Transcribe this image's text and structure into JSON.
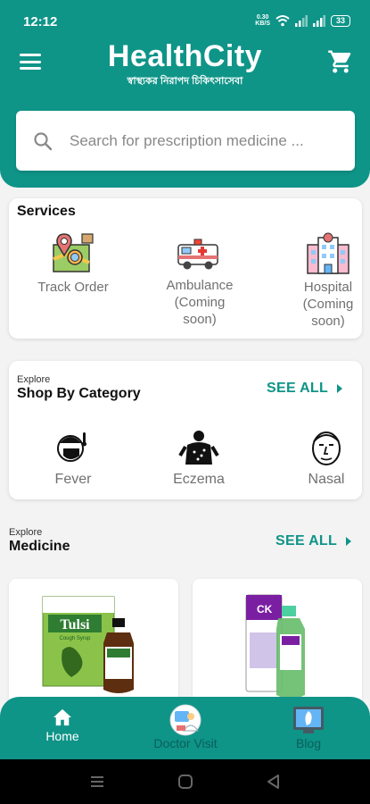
{
  "status": {
    "time": "12:12",
    "speed": "0.30",
    "speed_unit": "KB/S",
    "battery": "33"
  },
  "brand": {
    "name": "HealthCity",
    "tagline": "স্বাস্থ্যকর নিরাপদ চিকিৎসাসেবা"
  },
  "search": {
    "placeholder": "Search for prescription medicine ..."
  },
  "services": {
    "title": "Services",
    "items": [
      {
        "label": "Track Order",
        "icon": "map-pin-icon"
      },
      {
        "label": "Ambulance (Coming soon)",
        "line1": "Ambulance",
        "line2": "(Coming",
        "line3": "soon)",
        "icon": "ambulance-icon"
      },
      {
        "label": "Hospital (Coming soon)",
        "line1": "Hospital",
        "line2": "(Coming",
        "line3": "soon)",
        "icon": "hospital-icon"
      }
    ]
  },
  "category": {
    "explore": "Explore",
    "title": "Shop By Category",
    "see_all": "SEE ALL",
    "items": [
      {
        "label": "Fever",
        "icon": "fever-icon"
      },
      {
        "label": "Eczema",
        "icon": "eczema-icon"
      },
      {
        "label": "Nasal",
        "icon": "nasal-icon"
      }
    ]
  },
  "medicine": {
    "explore": "Explore",
    "title": "Medicine",
    "see_all": "SEE ALL",
    "products": [
      {
        "brand_text": "Tulsi",
        "sub_text": "Cough Syrup"
      },
      {
        "brand_text": "CK"
      }
    ]
  },
  "nav": {
    "items": [
      {
        "label": "Home",
        "active": true,
        "icon": "home-icon"
      },
      {
        "label": "Doctor Visit",
        "active": false,
        "icon": "doctor-icon"
      },
      {
        "label": "Blog",
        "active": false,
        "icon": "blog-icon"
      }
    ]
  },
  "colors": {
    "primary": "#0f9488",
    "nav_inactive": "#0a5f58"
  }
}
